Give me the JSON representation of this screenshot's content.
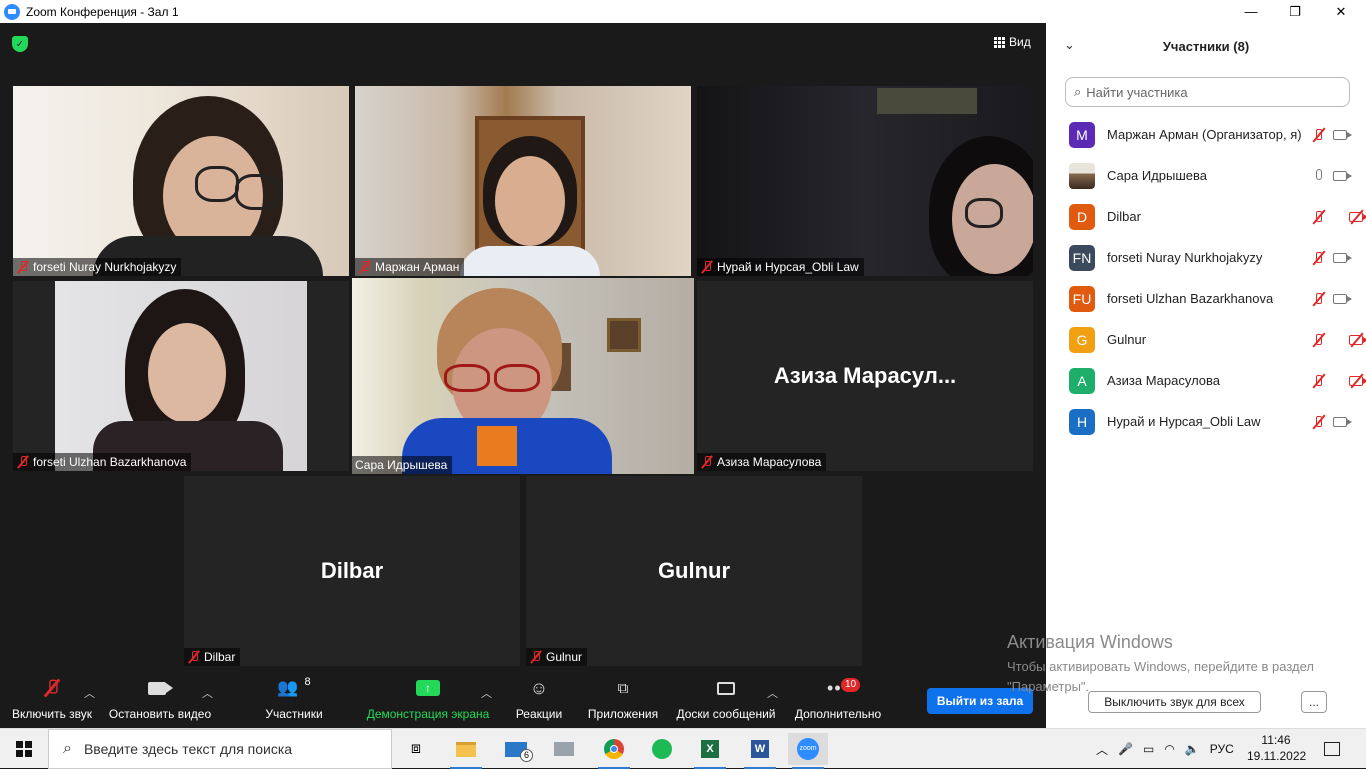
{
  "window": {
    "title": "Zoom Конференция - Зал 1",
    "minimize": "—",
    "maximize": "❐",
    "close": "✕"
  },
  "top": {
    "view_label": "Вид"
  },
  "tiles": [
    {
      "name": "forseti Nuray Nurkhojakyzy",
      "muted": true
    },
    {
      "name": "Маржан Арман",
      "muted": true
    },
    {
      "name": "Нурай и Нурсая_Obli Law",
      "muted": true
    },
    {
      "name": "forseti Ulzhan Bazarkhanova",
      "muted": true
    },
    {
      "name": "Сара Идрышева",
      "muted": false,
      "active": true
    },
    {
      "name": "Азиза Марасулова",
      "muted": true,
      "display_name": "Азиза  Марасул..."
    },
    {
      "name": "Dilbar",
      "muted": true,
      "display_name": "Dilbar"
    },
    {
      "name": "Gulnur",
      "muted": true,
      "display_name": "Gulnur"
    }
  ],
  "toolbar": {
    "mute_label": "Включить звук",
    "video_label": "Остановить видео",
    "participants_label": "Участники",
    "participants_count": "8",
    "share_label": "Демонстрация экрана",
    "reactions_label": "Реакции",
    "apps_label": "Приложения",
    "whiteboards_label": "Доски сообщений",
    "more_label": "Дополнительно",
    "more_badge": "10",
    "leave_label": "Выйти из зала"
  },
  "panel": {
    "title": "Участники (8)",
    "search_placeholder": "Найти участника",
    "participants": [
      {
        "initials": "M",
        "name": "Маржан Арман (Организатор, я)",
        "color": "#5b2bb5",
        "mic": "muted",
        "cam": "on"
      },
      {
        "initials": "",
        "name": "Сара Идрышева",
        "color": "#8a6a50",
        "mic": "on",
        "cam": "on",
        "photo": true
      },
      {
        "initials": "D",
        "name": "Dilbar",
        "color": "#e05a10",
        "mic": "muted",
        "cam": "off"
      },
      {
        "initials": "FN",
        "name": "forseti Nuray Nurkhojakyzy",
        "color": "#3a4a5c",
        "mic": "muted",
        "cam": "on"
      },
      {
        "initials": "FU",
        "name": "forseti Ulzhan Bazarkhanova",
        "color": "#e05a10",
        "mic": "muted",
        "cam": "on"
      },
      {
        "initials": "G",
        "name": "Gulnur",
        "color": "#f0a010",
        "mic": "muted",
        "cam": "off"
      },
      {
        "initials": "A",
        "name": "Азиза Марасулова",
        "color": "#1fae6a",
        "mic": "muted",
        "cam": "off"
      },
      {
        "initials": "H",
        "name": "Нурай и Нурсая_Obli Law",
        "color": "#1a6fc4",
        "mic": "muted",
        "cam": "on"
      }
    ],
    "mute_all_label": "Выключить звук для всех",
    "more_label": "..."
  },
  "activation": {
    "title": "Активация Windows",
    "text": "Чтобы активировать Windows, перейдите в раздел \"Параметры\"."
  },
  "taskbar": {
    "search_placeholder": "Введите здесь текст для поиска",
    "mail_badge": "6",
    "lang": "РУС",
    "time": "11:46",
    "date": "19.11.2022"
  }
}
